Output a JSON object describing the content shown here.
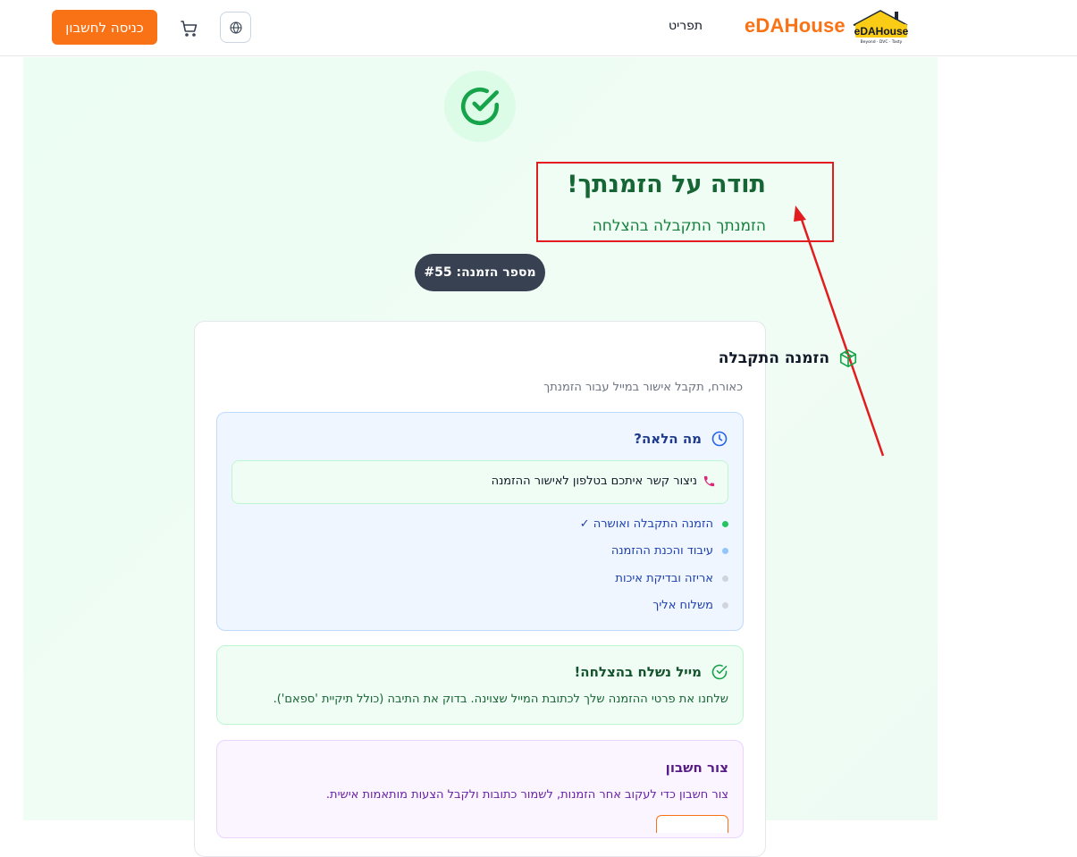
{
  "header": {
    "login_label": "כניסה לחשבון",
    "menu_label": "תפריט",
    "brand": "eDAHouse",
    "logo_text": "eDAHouse",
    "logo_tagline": "Beyond · DVC · Tasty",
    "icons": {
      "cart": "cart-icon",
      "language": "globe-icon"
    }
  },
  "confirmation": {
    "title": "תודה על הזמנתך!",
    "subtitle": "הזמנתך התקבלה בהצלחה",
    "order_number": "מספר הזמנה: #55"
  },
  "card": {
    "title": "הזמנה התקבלה",
    "subtitle": "כאורח, תקבל אישור במייל עבור הזמנתך",
    "next": {
      "heading": "מה הלאה?",
      "contact": "ניצור קשר איתכם בטלפון לאישור ההזמנה",
      "steps": [
        {
          "label": "הזמנה התקבלה ואושרה ✓",
          "color": "#22c55e"
        },
        {
          "label": "עיבוד והכנת ההזמנה",
          "color": "#93c5fd"
        },
        {
          "label": "אריזה ובדיקת איכות",
          "color": "#d1d5db"
        },
        {
          "label": "משלוח אליך",
          "color": "#d1d5db"
        }
      ]
    },
    "email": {
      "heading": "מייל נשלח בהצלחה!",
      "text": "שלחנו את פרטי ההזמנה שלך לכתובת המייל שצוינה. בדוק את התיבה (כולל תיקיית 'ספאם')."
    },
    "account": {
      "heading": "צור חשבון",
      "text": "צור חשבון כדי לעקוב אחר הזמנות, לשמור כתובות ולקבל הצעות מותאמות אישית."
    }
  },
  "colors": {
    "accent": "#f97316",
    "success": "#16a34a",
    "annotation": "#e11d20"
  }
}
